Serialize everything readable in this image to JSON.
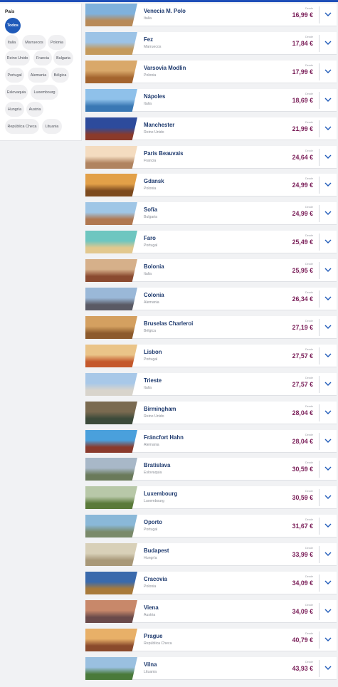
{
  "filters": {
    "title": "País",
    "chips": [
      {
        "label": "Todos",
        "active": true
      },
      {
        "label": "Italia"
      },
      {
        "label": "Marruecos"
      },
      {
        "label": "Polonia"
      },
      {
        "label": "Reino Unido"
      },
      {
        "label": "Francia"
      },
      {
        "label": "Bulgaria"
      },
      {
        "label": "Portugal"
      },
      {
        "label": "Alemania"
      },
      {
        "label": "Bélgica"
      },
      {
        "label": "Eslovaquia"
      },
      {
        "label": "Luxembourg"
      },
      {
        "label": "Hungría"
      },
      {
        "label": "Austria"
      },
      {
        "label": "República Checa"
      },
      {
        "label": "Lituania"
      }
    ]
  },
  "price_prefix": "Desde",
  "destinations": [
    {
      "city": "Venecia M. Polo",
      "country": "Italia",
      "price": "16,99 €",
      "sky": "#7fb1dc",
      "ground": "#b88a58"
    },
    {
      "city": "Fez",
      "country": "Marruecos",
      "price": "17,84 €",
      "sky": "#9cc3e6",
      "ground": "#c49a5c"
    },
    {
      "city": "Varsovia Modlin",
      "country": "Polonia",
      "price": "17,99 €",
      "sky": "#d9a86a",
      "ground": "#a4642e"
    },
    {
      "city": "Nápoles",
      "country": "Italia",
      "price": "18,69 €",
      "sky": "#8fc1ea",
      "ground": "#3a78b4"
    },
    {
      "city": "Manchester",
      "country": "Reino Unido",
      "price": "21,99 €",
      "sky": "#2d4b9c",
      "ground": "#8b3a2a"
    },
    {
      "city": "Paris Beauvais",
      "country": "Francia",
      "price": "24,64 €",
      "sky": "#f4dcc0",
      "ground": "#b08460"
    },
    {
      "city": "Gdansk",
      "country": "Polonia",
      "price": "24,99 €",
      "sky": "#e2a048",
      "ground": "#7c4a1e"
    },
    {
      "city": "Sofía",
      "country": "Bulgaria",
      "price": "24,99 €",
      "sky": "#9fc6e6",
      "ground": "#b07850"
    },
    {
      "city": "Faro",
      "country": "Portugal",
      "price": "25,49 €",
      "sky": "#6ec6c0",
      "ground": "#e2c88e"
    },
    {
      "city": "Bolonia",
      "country": "Italia",
      "price": "25,95 €",
      "sky": "#d6b08a",
      "ground": "#8a4a30"
    },
    {
      "city": "Colonia",
      "country": "Alemania",
      "price": "26,34 €",
      "sky": "#9ab8d8",
      "ground": "#5a5a64"
    },
    {
      "city": "Bruselas Charleroi",
      "country": "Bélgica",
      "price": "27,19 €",
      "sky": "#d4a060",
      "ground": "#8c5a2c"
    },
    {
      "city": "Lisbon",
      "country": "Portugal",
      "price": "27,57 €",
      "sky": "#eac488",
      "ground": "#c4582c"
    },
    {
      "city": "Trieste",
      "country": "Italia",
      "price": "27,57 €",
      "sky": "#a8c8e8",
      "ground": "#d8d4cc"
    },
    {
      "city": "Birmingham",
      "country": "Reino Unido",
      "price": "28,04 €",
      "sky": "#7a6a50",
      "ground": "#3c4a3a"
    },
    {
      "city": "Fráncfort Hahn",
      "country": "Alemania",
      "price": "28,04 €",
      "sky": "#4aa0dc",
      "ground": "#8a3a2c"
    },
    {
      "city": "Bratislava",
      "country": "Eslovaquia",
      "price": "30,59 €",
      "sky": "#a8b8c8",
      "ground": "#6a7a5a"
    },
    {
      "city": "Luxembourg",
      "country": "Luxembourg",
      "price": "30,59 €",
      "sky": "#b8c8a8",
      "ground": "#5a7a3a"
    },
    {
      "city": "Oporto",
      "country": "Portugal",
      "price": "31,67 €",
      "sky": "#8ab8d8",
      "ground": "#7a8a6a"
    },
    {
      "city": "Budapest",
      "country": "Hungría",
      "price": "33,99 €",
      "sky": "#d8d0b8",
      "ground": "#a89878"
    },
    {
      "city": "Cracovia",
      "country": "Polonia",
      "price": "34,09 €",
      "sky": "#3a6aac",
      "ground": "#a87a3a"
    },
    {
      "city": "Viena",
      "country": "Austria",
      "price": "34,09 €",
      "sky": "#c8886a",
      "ground": "#6a4a4a"
    },
    {
      "city": "Prague",
      "country": "República Checa",
      "price": "40,79 €",
      "sky": "#e8b068",
      "ground": "#8a4a2c"
    },
    {
      "city": "Vilna",
      "country": "Lituania",
      "price": "43,93 €",
      "sky": "#9ac0e0",
      "ground": "#4a7a3a"
    }
  ],
  "colors": {
    "brand": "#1f4fb8",
    "price": "#7a1e58",
    "city": "#1e3a6e"
  },
  "icons": {
    "expand": "chevron-down-icon"
  }
}
